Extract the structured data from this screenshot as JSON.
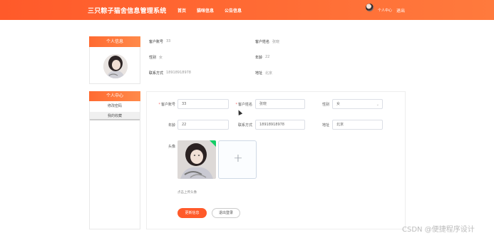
{
  "header": {
    "title": "三只粽子猫舍信息管理系统",
    "nav": [
      "首页",
      "猫咪信息",
      "公告信息"
    ],
    "user_center": "个人中心",
    "logout": "退出"
  },
  "sidebar": {
    "profile_title": "个人信息",
    "center_title": "个人中心",
    "menu": [
      "修改密码",
      "我的收藏"
    ]
  },
  "summary": {
    "account_label": "客户账号",
    "account_value": "33",
    "name_label": "客户姓名",
    "name_value": "张晓",
    "gender_label": "性别",
    "gender_value": "女",
    "age_label": "年龄",
    "age_value": "22",
    "phone_label": "联系方式",
    "phone_value": "18918918978",
    "address_label": "地址",
    "address_value": "北京"
  },
  "form": {
    "account_label": "客户账号",
    "account_value": "33",
    "name_label": "客户姓名",
    "name_value": "张晓",
    "gender_label": "性别",
    "gender_value": "女",
    "age_label": "年龄",
    "age_value": "22",
    "phone_label": "联系方式",
    "phone_value": "18918918978",
    "address_label": "地址",
    "address_value": "北京",
    "avatar_label": "头像",
    "upload_hint": "点击上传头像",
    "submit_label": "更新信息",
    "logout_label": "退出登录"
  },
  "icons": {
    "upload": "plus-icon",
    "select": "chevron-down-icon"
  },
  "colors": {
    "accent": "#ff5a2a",
    "success": "#13ce66"
  },
  "watermark": "CSDN @便捷程序设计"
}
